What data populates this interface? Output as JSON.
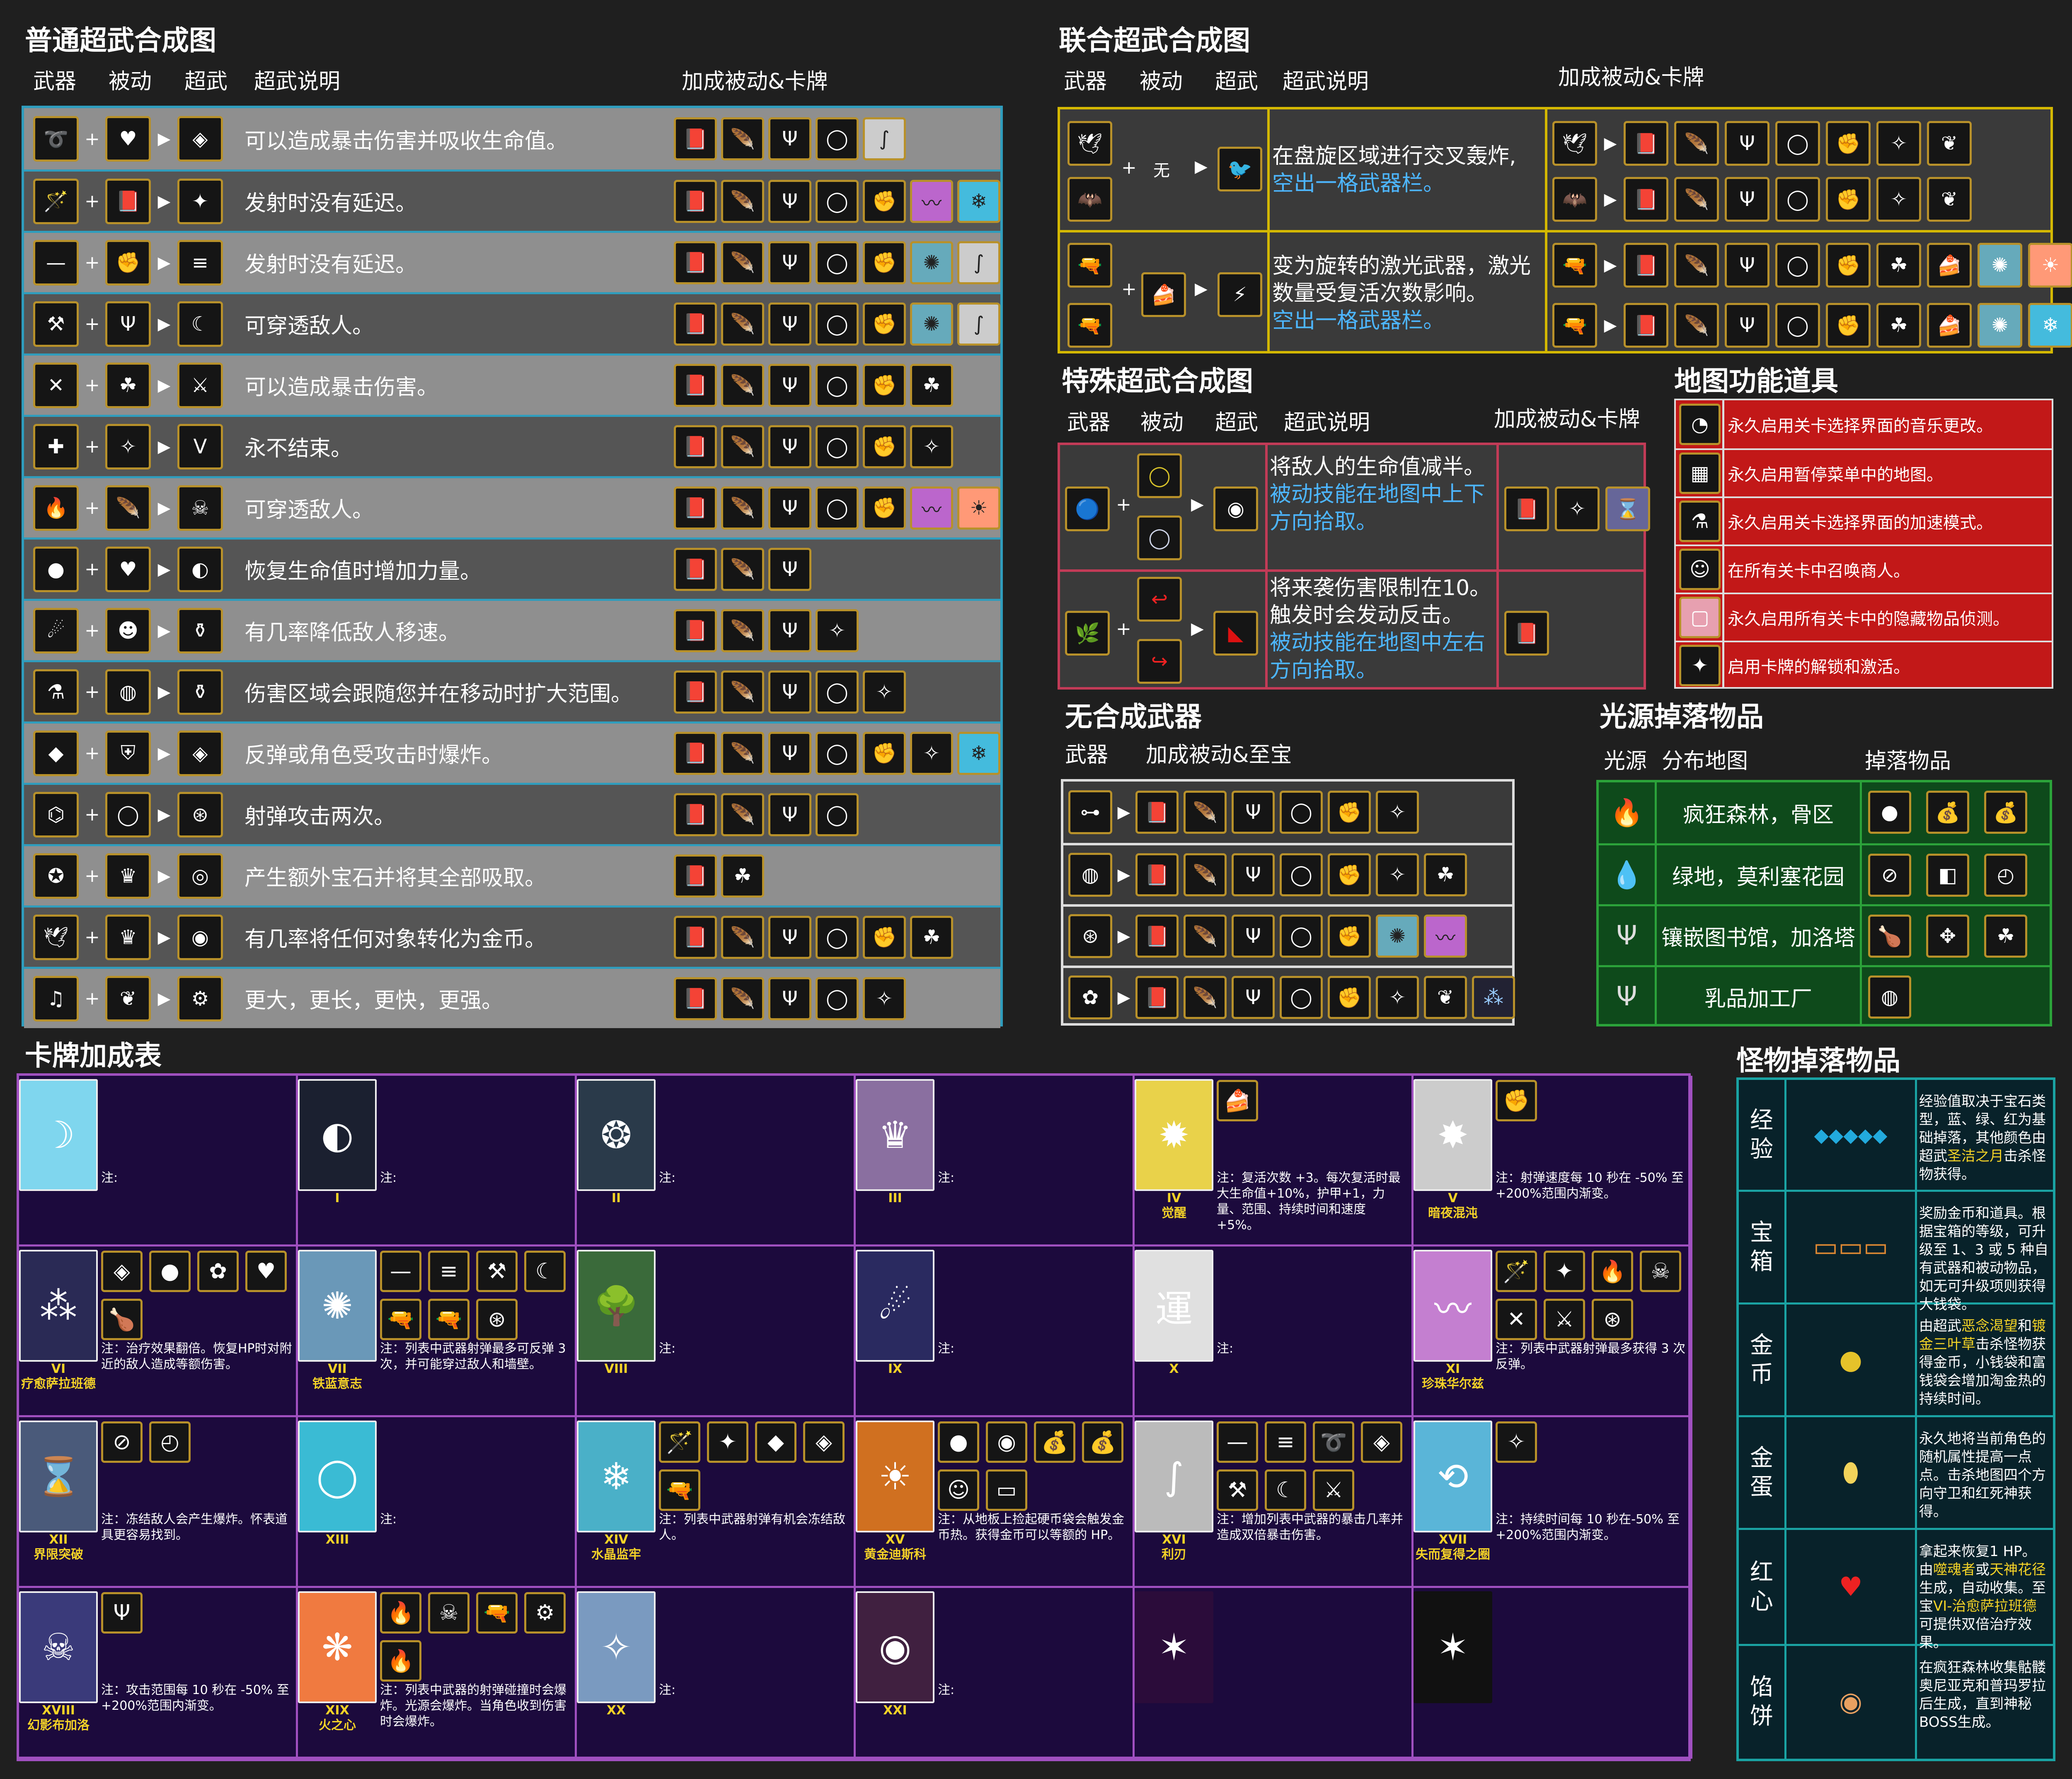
{
  "sections": {
    "normal": {
      "title": "普通超武合成图",
      "headers": {
        "weapon": "武器",
        "passive": "被动",
        "evo": "超武",
        "desc": "超武说明",
        "bonus": "加成被动&卡牌"
      },
      "rows": [
        {
          "desc": "可以造成暴击伤害并吸收生命值。",
          "icons": [
            "whip-icon",
            "heart-icon",
            "bloody-tear-icon"
          ],
          "bonus": [
            "book-icon",
            "feather-icon",
            "candelabra-icon",
            "ring-icon",
            "card-xvi-icon"
          ]
        },
        {
          "desc": "发射时没有延迟。",
          "icons": [
            "wand-icon",
            "book-icon",
            "holy-wand-icon"
          ],
          "bonus": [
            "book-icon",
            "feather-icon",
            "candelabra-icon",
            "ring-icon",
            "gauntlet-icon",
            "card-xi-icon",
            "card-xiv-icon"
          ]
        },
        {
          "desc": "发射时没有延迟。",
          "icons": [
            "knife-icon",
            "gauntlet-icon",
            "thousand-edge-icon"
          ],
          "bonus": [
            "book-icon",
            "feather-icon",
            "candelabra-icon",
            "ring-icon",
            "gauntlet-icon",
            "card-vii-icon",
            "card-xvi-icon"
          ]
        },
        {
          "desc": "可穿透敌人。",
          "icons": [
            "axe-icon",
            "candelabra-icon",
            "death-spiral-icon"
          ],
          "bonus": [
            "book-icon",
            "feather-icon",
            "candelabra-icon",
            "ring-icon",
            "gauntlet-icon",
            "card-vii-icon",
            "card-xvi-icon"
          ]
        },
        {
          "desc": "可以造成暴击伤害。",
          "icons": [
            "cross-icon",
            "clover-icon",
            "heaven-sword-icon"
          ],
          "bonus": [
            "book-icon",
            "feather-icon",
            "candelabra-icon",
            "ring-icon",
            "gauntlet-icon",
            "clover-icon"
          ]
        },
        {
          "desc": "永不结束。",
          "icons": [
            "bible-icon",
            "spellbinder-icon",
            "unholy-vespers-icon"
          ],
          "bonus": [
            "book-icon",
            "feather-icon",
            "candelabra-icon",
            "ring-icon",
            "gauntlet-icon",
            "spellbinder-icon"
          ]
        },
        {
          "desc": "可穿透敌人。",
          "icons": [
            "fire-wand-icon",
            "feather-icon",
            "hellfire-icon"
          ],
          "bonus": [
            "book-icon",
            "feather-icon",
            "candelabra-icon",
            "ring-icon",
            "gauntlet-icon",
            "card-xi-icon",
            "card-xix-icon"
          ]
        },
        {
          "desc": "恢复生命值时增加力量。",
          "icons": [
            "garlic-icon",
            "heart-icon",
            "soul-eater-icon"
          ],
          "bonus": [
            "book-icon",
            "feather-icon",
            "candelabra-icon"
          ]
        },
        {
          "desc": "有几率降低敌人移速。",
          "icons": [
            "water-icon",
            "skull-icon",
            "la-borra-icon"
          ],
          "bonus": [
            "book-icon",
            "feather-icon",
            "candelabra-icon",
            "spellbinder-icon"
          ]
        },
        {
          "desc": "伤害区域会跟随您并在移动时扩大范围。",
          "icons": [
            "holy-water-icon",
            "orb-icon",
            "la-borra-icon"
          ],
          "bonus": [
            "book-icon",
            "feather-icon",
            "candelabra-icon",
            "ring-icon",
            "spellbinder-icon"
          ]
        },
        {
          "desc": "反弹或角色受攻击时爆炸。",
          "icons": [
            "runetracer-icon",
            "armor-icon",
            "no-future-icon"
          ],
          "bonus": [
            "book-icon",
            "feather-icon",
            "candelabra-icon",
            "ring-icon",
            "gauntlet-icon",
            "spellbinder-icon",
            "card-xiv-icon"
          ]
        },
        {
          "desc": "射弹攻击两次。",
          "icons": [
            "lightning-icon",
            "duplicator-icon",
            "thunder-loop-icon"
          ],
          "bonus": [
            "book-icon",
            "feather-icon",
            "candelabra-icon",
            "ring-icon"
          ]
        },
        {
          "desc": "产生额外宝石并将其全部吸取。",
          "icons": [
            "pentagram-icon",
            "crown-icon",
            "gorgeous-moon-icon"
          ],
          "bonus": [
            "book-icon",
            "clover-icon"
          ]
        },
        {
          "desc": "有几率将任何对象转化为金币。",
          "icons": [
            "peachone-icon",
            "crown-icon",
            "vandalier-icon"
          ],
          "bonus": [
            "book-icon",
            "feather-icon",
            "candelabra-icon",
            "ring-icon",
            "gauntlet-icon",
            "clover-icon"
          ]
        },
        {
          "desc": "更大，更长，更快，更强。",
          "icons": [
            "song-icon",
            "wings-icon",
            "mannajja-icon"
          ],
          "bonus": [
            "book-icon",
            "feather-icon",
            "candelabra-icon",
            "ring-icon",
            "spellbinder-icon"
          ]
        }
      ]
    },
    "union": {
      "title": "联合超武合成图",
      "headers": {
        "weapon": "武器",
        "passive": "被动",
        "evo": "超武",
        "desc": "超武说明",
        "bonus": "加成被动&卡牌"
      },
      "none_label": "无",
      "rows": [
        {
          "desc1": "在盘旋区域进行交叉轰炸,",
          "desc2": "空出一格武器栏。"
        },
        {
          "desc1": "变为旋转的激光武器，激光",
          "desc2": "数量受复活次数影响。",
          "desc3": "空出一格武器栏。"
        }
      ]
    },
    "special": {
      "title": "特殊超武合成图",
      "headers": {
        "weapon": "武器",
        "passive": "被动",
        "evo": "超武",
        "desc": "超武说明",
        "bonus": "加成被动&卡牌"
      },
      "rows": [
        {
          "desc1": "将敌人的生命值减半。",
          "desc2": "被动技能在地图中上下",
          "desc3": "方向拾取。"
        },
        {
          "desc1": "将来袭伤害限制在10。",
          "desc2": "触发时会发动反击。",
          "desc3": "被动技能在地图中左右",
          "desc4": "方向拾取。"
        }
      ]
    },
    "map_items": {
      "title": "地图功能道具",
      "items": [
        "永久启用关卡选择界面的音乐更改。",
        "永久启用暂停菜单中的地图。",
        "永久启用关卡选择界面的加速模式。",
        "在所有关卡中召唤商人。",
        "永久启用所有关卡中的隐藏物品侦测。",
        "启用卡牌的解锁和激活。"
      ]
    },
    "no_evo": {
      "title": "无合成武器",
      "headers": {
        "weapon": "武器",
        "bonus": "加成被动&至宝"
      }
    },
    "light": {
      "title": "光源掉落物品",
      "headers": {
        "source": "光源",
        "map": "分布地图",
        "drops": "掉落物品"
      },
      "rows": [
        "疯狂森林，骨区",
        "绿地，莫利塞花园",
        "镶嵌图书馆，加洛塔",
        "乳品加工厂"
      ]
    },
    "cards": {
      "title": "卡牌加成表",
      "note_prefix": "注:",
      "list": [
        {
          "num": "",
          "name": "",
          "note": ""
        },
        {
          "num": "I",
          "name": "",
          "note": ""
        },
        {
          "num": "II",
          "name": "",
          "note": ""
        },
        {
          "num": "III",
          "name": "",
          "note": ""
        },
        {
          "num": "IV",
          "name": "觉醒",
          "note": "注：复活次数 +3。每次复活时最大生命值+10%，护甲+1，力量、范围、持续时间和速度 +5%。"
        },
        {
          "num": "V",
          "name": "暗夜混沌",
          "note": "注：射弹速度每 10 秒在 -50% 至 +200%范围内渐变。"
        },
        {
          "num": "VI",
          "name": "疗愈萨拉班德",
          "note": "注：治疗效果翻倍。恢复HP时对附近的敌人造成等额伤害。"
        },
        {
          "num": "VII",
          "name": "铁蓝意志",
          "note": "注：列表中武器射弹最多可反弹 3 次，并可能穿过敌人和墙壁。"
        },
        {
          "num": "VIII",
          "name": "",
          "note": ""
        },
        {
          "num": "IX",
          "name": "",
          "note": ""
        },
        {
          "num": "X",
          "name": "",
          "note": ""
        },
        {
          "num": "XI",
          "name": "珍珠华尔兹",
          "note": "注：列表中武器射弹最多获得 3 次反弹。"
        },
        {
          "num": "XII",
          "name": "界限突破",
          "note": "注：冻结敌人会产生爆炸。怀表道具更容易找到。"
        },
        {
          "num": "XIII",
          "name": "",
          "note": ""
        },
        {
          "num": "XIV",
          "name": "水晶监牢",
          "note": "注：列表中武器射弹有机会冻结敌人。"
        },
        {
          "num": "XV",
          "name": "黄金迪斯科",
          "note": "注：从地板上捡起硬币袋会触发金币热。获得金币可以等额的 HP。"
        },
        {
          "num": "XVI",
          "name": "利刃",
          "note": "注：增加列表中武器的暴击几率并造成双倍暴击伤害。"
        },
        {
          "num": "XVII",
          "name": "失而复得之圈",
          "note": "注：持续时间每 10 秒在-50% 至 +200%范围内渐变。"
        },
        {
          "num": "XVIII",
          "name": "幻影布加洛",
          "note": "注：攻击范围每 10 秒在 -50% 至 +200%范围内渐变。"
        },
        {
          "num": "XIX",
          "name": "火之心",
          "note": "注：列表中武器的射弹碰撞时会爆炸。光源会爆炸。当角色收到伤害时会爆炸。"
        },
        {
          "num": "XX",
          "name": "",
          "note": ""
        },
        {
          "num": "XXI",
          "name": "",
          "note": ""
        },
        {
          "num": "",
          "name": "",
          "note": ""
        },
        {
          "num": "",
          "name": "",
          "note": ""
        }
      ]
    },
    "monster": {
      "title": "怪物掉落物品",
      "rows": [
        {
          "name1": "经",
          "name2": "验",
          "t1": "经验值取决于宝石类型，蓝、绿、红为基础掉落，其他颜色由超武",
          "t1y": "圣洁之月",
          "t1b": "击杀怪物获得。"
        },
        {
          "name1": "宝",
          "name2": "箱",
          "t1": "奖励金币和道具。根据宝箱的等级，可升级至 1、3 或 5 种自有武器和被动物品，如无可升级项则获得大钱袋。",
          "t1y": "",
          "t1b": ""
        },
        {
          "name1": "金",
          "name2": "币",
          "t1": "由超武",
          "t1y": "恶念渴望",
          "t1m": "和",
          "t1y2": "镀金三叶草",
          "t1b": "击杀怪物获得金币，小钱袋和富钱袋会增加淘金热的持续时间。"
        },
        {
          "name1": "金",
          "name2": "蛋",
          "t1": "永久地将当前角色的随机属性提高一点点。击杀地图四个方向守卫和红死神获得。",
          "t1y": "",
          "t1b": ""
        },
        {
          "name1": "红",
          "name2": "心",
          "t1": "拿起来恢复1 HP。由",
          "t1y": "噬魂者",
          "t1m": "或",
          "t1y2": "天神花径",
          "t1b": "生成，自动收集。至宝",
          "t1y3": "VI-治愈萨拉班德",
          "t1b2": "可提供双倍治疗效果。"
        },
        {
          "name1": "馅",
          "name2": "饼",
          "t1": "在疯狂森林收集骷髅奥尼亚克和普玛罗拉后生成，直到神秘BOSS生成。",
          "t1y": "",
          "t1b": ""
        }
      ]
    }
  },
  "colors": {
    "accent_blue": "#2f9dbd",
    "card_border": "#a050c0",
    "teal": "#1aa3a3",
    "gold": "#b8912a",
    "red_panel": "#c21818",
    "green_panel": "#0e4a1b",
    "purple_panel": "#1c0a3d",
    "text_yellow": "#f5d327",
    "text_blue": "#4db6ff"
  }
}
